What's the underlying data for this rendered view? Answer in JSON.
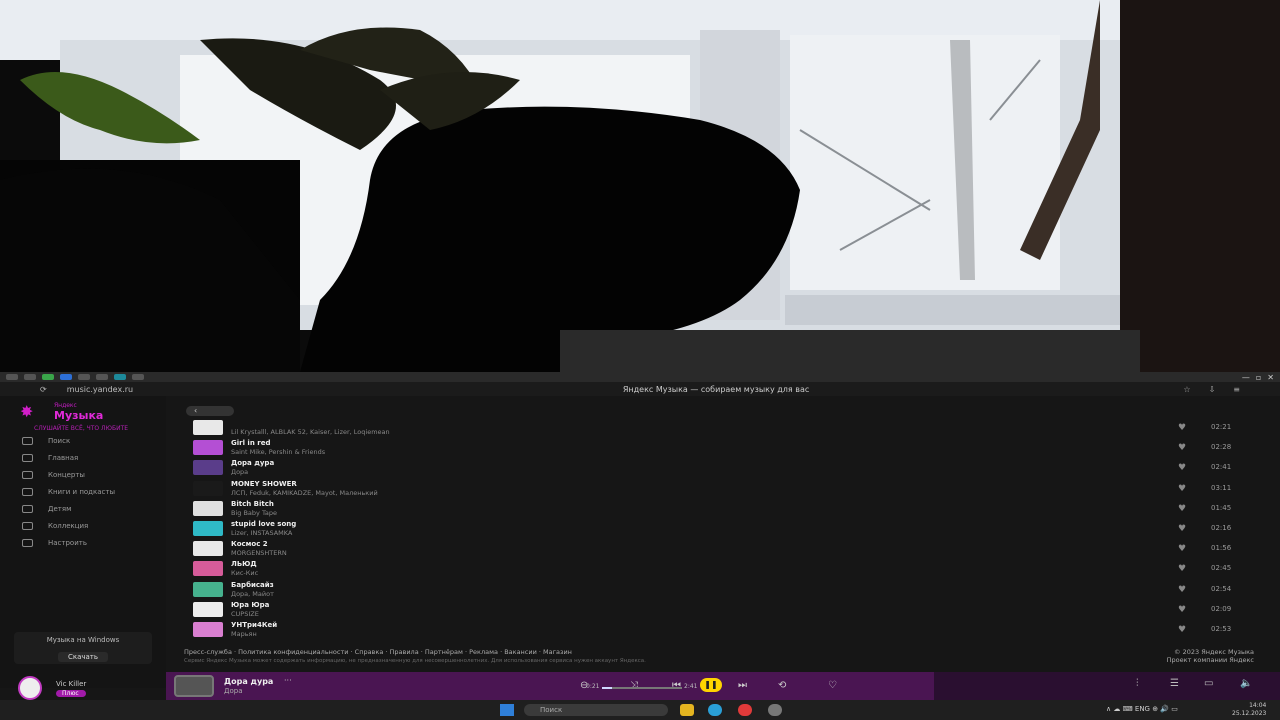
{
  "browser": {
    "url": "music.yandex.ru",
    "title": "Яндекс Музыка — собираем музыку для вас"
  },
  "sidebar": {
    "logo_small": "Яндекс",
    "logo_main": "Музыка",
    "tagline": "СЛУШАЙТЕ ВСЁ, ЧТО ЛЮБИТЕ",
    "items": [
      {
        "label": "Поиск",
        "icon": "search-icon"
      },
      {
        "label": "Главная",
        "icon": "home-icon"
      },
      {
        "label": "Концерты",
        "icon": "ticket-icon"
      },
      {
        "label": "Книги и подкасты",
        "icon": "book-icon"
      },
      {
        "label": "Детям",
        "icon": "kids-icon"
      },
      {
        "label": "Коллекция",
        "icon": "heart-icon"
      },
      {
        "label": "Настроить",
        "icon": "settings-icon"
      }
    ],
    "promo_title": "Музыка на Windows",
    "promo_button": "Скачать",
    "user_name": "Vic Killer",
    "user_badge": "Плюс"
  },
  "tracks": [
    {
      "title": "",
      "artist": "Lil Krystalll, ALBLAK 52, Kaiser, Lizer, Loqiemean",
      "duration": "02:21",
      "color": "#e8e8e8"
    },
    {
      "title": "Girl in red",
      "artist": "Saint Mike, Pershin & Friends",
      "duration": "02:28",
      "color": "#b44fd4"
    },
    {
      "title": "Дора дура",
      "artist": "Дора",
      "duration": "02:41",
      "color": "#5a3d8a"
    },
    {
      "title": "MONEY SHOWER",
      "artist": "ЛСП, Feduk, KAMIKADZE, Mayot, Маленький",
      "duration": "03:11",
      "color": "#1a1a1a"
    },
    {
      "title": "Bitch Bitch",
      "artist": "Big Baby Tape",
      "duration": "01:45",
      "color": "#e0e0e0"
    },
    {
      "title": "stupid love song",
      "artist": "Lizer, INSTASAMKA",
      "duration": "02:16",
      "color": "#2fb9c6"
    },
    {
      "title": "Космос 2",
      "artist": "MORGENSHTERN",
      "duration": "01:56",
      "color": "#e8e8e8"
    },
    {
      "title": "ЛЬЮД",
      "artist": "Кис-Кис",
      "duration": "02:45",
      "color": "#d65c9a"
    },
    {
      "title": "Барбисайз",
      "artist": "Дора, Майот",
      "duration": "02:54",
      "color": "#46b28e"
    },
    {
      "title": "Юра Юра",
      "artist": "CUPSIZE",
      "duration": "02:09",
      "color": "#ededed"
    },
    {
      "title": "УНТри4Кей",
      "artist": "Марьян",
      "duration": "02:53",
      "color": "#d97fd0"
    }
  ],
  "footer": {
    "links": "Пресс-служба · Политика конфиденциальности · Справка · Правила · Партнёрам · Реклама · Вакансии · Магазин",
    "description": "Сервис Яндекс Музыка может содержать информацию, не предназначенную для несовершеннолетних. Для использования сервиса нужен аккаунт Яндекса.",
    "copyright": "© 2023 Яндекс Музыка",
    "company": "Проект компании Яндекс"
  },
  "player": {
    "title": "Дора дура",
    "artist": "Дора",
    "more": "···",
    "time_current": "0:21",
    "time_total": "2:41",
    "progress": 0.13
  },
  "taskbar": {
    "search_placeholder": "Поиск",
    "tray": "∧   ☁   ⌨   ENG   ⊕   🔊   ▭",
    "time": "14:04",
    "date": "25.12.2023"
  }
}
